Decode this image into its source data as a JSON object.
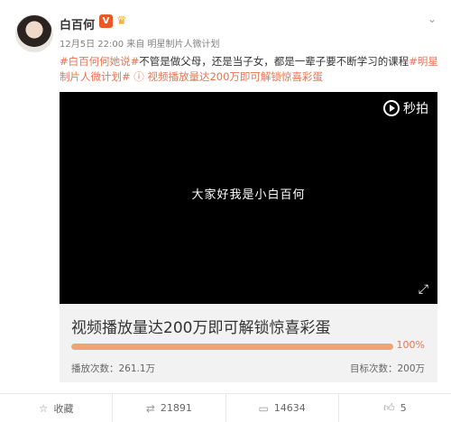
{
  "post": {
    "username": "白百何",
    "vip_badge": "V",
    "meta": "12月5日 22:00 来自 明星制片人微计划",
    "text_segments": [
      {
        "text": "#白百何何她说#",
        "type": "hashtag"
      },
      {
        "text": "不管是做父母，还是当子女，都是一辈子要不断学习的课程",
        "type": "plain"
      },
      {
        "text": "#明星制片人微计划#",
        "type": "hashtag"
      },
      {
        "text": " ⓘ 视频播放量达200万即可解锁惊喜彩蛋",
        "type": "link"
      }
    ]
  },
  "video": {
    "logo_text": "秒拍",
    "subtitle": "大家好我是小白百何"
  },
  "progress": {
    "title": "视频播放量达200万即可解锁惊喜彩蛋",
    "percent_label": "100%",
    "percent": 1.0,
    "plays_label": "播放次数：261.1万",
    "target_label": "目标次数：200万"
  },
  "actions": {
    "favorite": "收藏",
    "repost": "21891",
    "comment": "14634",
    "like": "5"
  },
  "colors": {
    "accent": "#eb7350",
    "progress_fill": "#f0a374"
  }
}
